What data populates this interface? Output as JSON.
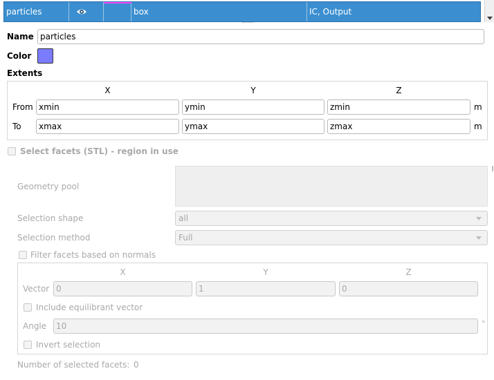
{
  "table_row": {
    "name": "particles",
    "shape": "box",
    "usage": "IC, Output",
    "swatch_color": "#ff44ff"
  },
  "region": {
    "name_label": "Name",
    "name_value": "particles",
    "color_label": "Color",
    "color_value": "#7b7bff",
    "extents_label": "Extents",
    "axes": [
      "X",
      "Y",
      "Z"
    ],
    "from_label": "From",
    "to_label": "To",
    "from_values": [
      "xmin",
      "ymin",
      "zmin"
    ],
    "to_values": [
      "xmax",
      "ymax",
      "zmax"
    ],
    "unit": "m"
  },
  "stl": {
    "select_facets_label": "Select facets (STL) - region in use",
    "geometry_pool_label": "Geometry pool",
    "selection_shape_label": "Selection shape",
    "selection_shape_value": "all",
    "selection_method_label": "Selection method",
    "selection_method_value": "Full",
    "filter_label": "Filter facets based on normals",
    "axes": [
      "X",
      "Y",
      "Z"
    ],
    "vector_label": "Vector",
    "vector_values": [
      "0",
      "1",
      "0"
    ],
    "equilibrant_label": "Include equilibrant vector",
    "angle_label": "Angle",
    "angle_value": "10",
    "angle_unit": "°",
    "invert_label": "Invert selection",
    "count_label": "Number of selected facets:",
    "count_value": "0"
  }
}
